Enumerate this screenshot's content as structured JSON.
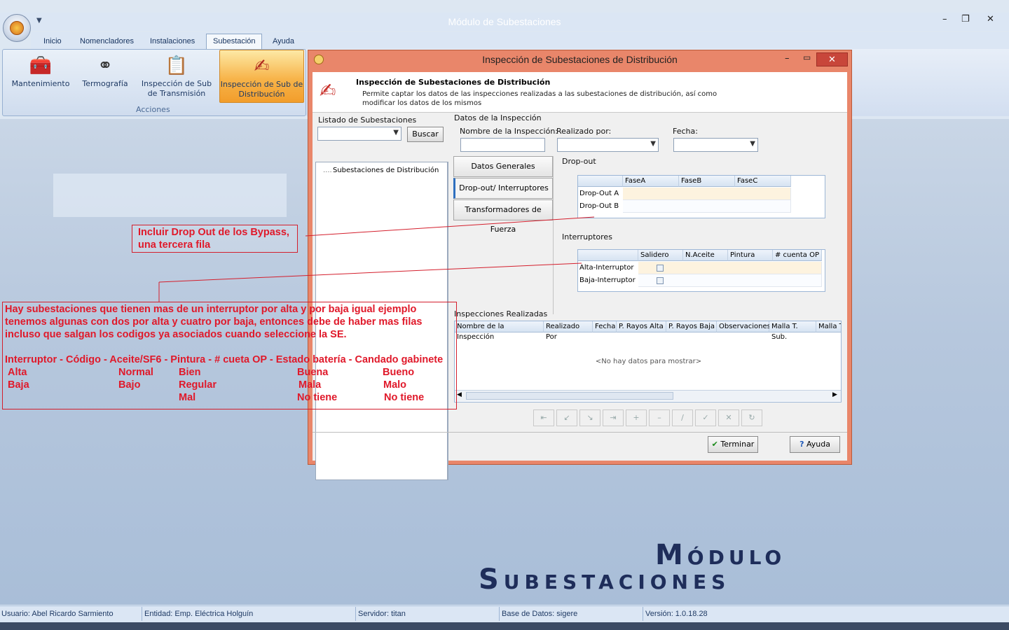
{
  "window": {
    "title": "Módulo de Subestaciones",
    "minimize": "–",
    "maximize": "❐",
    "close": "✕"
  },
  "menu": [
    "Inicio",
    "Nomencladores",
    "Instalaciones",
    "Subestación",
    "Ayuda"
  ],
  "ribbon": {
    "buttons": [
      {
        "label": "Mantenimiento",
        "icon": "toolbox-icon"
      },
      {
        "label": "Termografía",
        "icon": "binoculars-icon"
      },
      {
        "label": "Inspección de Sub de Transmisión",
        "icon": "clipboard-icon"
      },
      {
        "label": "Inspección de Sub de Distribución",
        "icon": "pencil-form-icon"
      }
    ],
    "group": "Acciones"
  },
  "dialog": {
    "title": "Inspección de Subestaciones de Distribución",
    "header_title": "Inspección de Subestaciones de Distribución",
    "header_desc": "Permite captar los datos de las inspecciones realizadas a las subestaciones de distribución, así como modificar los datos de los mismos",
    "list_label": "Listado de Subestaciones",
    "search_button": "Buscar",
    "tree_root": "Subestaciones de Distribución",
    "data_label": "Datos de la Inspección",
    "name_label": "Nombre de la Inspección:",
    "by_label": "Realizado por:",
    "date_label": "Fecha:",
    "tabs": [
      "Datos Generales",
      "Drop-out/ Interruptores",
      "Transformadores de Fuerza"
    ],
    "dropout": {
      "label": "Drop-out",
      "columns": [
        "FaseA",
        "FaseB",
        "FaseC"
      ],
      "rows": [
        "Drop-Out A",
        "Drop-Out B"
      ]
    },
    "interruptores": {
      "label": "Interruptores",
      "columns": [
        "Salidero",
        "N.Aceite",
        "Pintura",
        "# cuenta OP"
      ],
      "rows": [
        "Alta-Interruptor",
        "Baja-Interruptor"
      ]
    },
    "realizadas": {
      "label": "Inspecciones Realizadas",
      "columns": [
        "Nombre de la Inspección",
        "Realizado Por",
        "Fecha",
        "P. Rayos Alta",
        "P. Rayos Baja",
        "Observaciones",
        "Malla T. Sub.",
        "Malla T"
      ],
      "empty": "<No hay datos para mostrar>"
    },
    "terminar": "Terminar",
    "ayuda": "Ayuda"
  },
  "annotations": {
    "a1": "Incluir Drop Out de los Bypass,\nuna tercera fila",
    "a2": "Hay subestaciones que tienen mas de un interruptor por alta y por baja igual ejemplo\ntenemos algunas con dos por alta y cuatro por baja, entonces debe de haber mas filas\nincluso que salgan los codigos ya asociados cuando seleccione la SE.\n\nInterruptor - Código - Aceite/SF6 - Pintura - # cueta OP - Estado batería - Candado gabinete",
    "table": [
      [
        "Alta",
        "Normal",
        "Bien",
        "Buena",
        "Bueno"
      ],
      [
        "Baja",
        "Bajo",
        "Regular",
        "Mala",
        "Malo"
      ],
      [
        "",
        "",
        "Mal",
        "No tiene",
        "No tiene"
      ]
    ]
  },
  "status": {
    "usuario": "Usuario: Abel Ricardo Sarmiento",
    "entidad": "Entidad: Emp. Eléctrica Holguín",
    "servidor": "Servidor: titan",
    "bd": "Base de Datos: sigere",
    "version": "Versión: 1.0.18.28"
  },
  "logo": {
    "line1": "Módulo",
    "line2": "Subestaciones"
  }
}
